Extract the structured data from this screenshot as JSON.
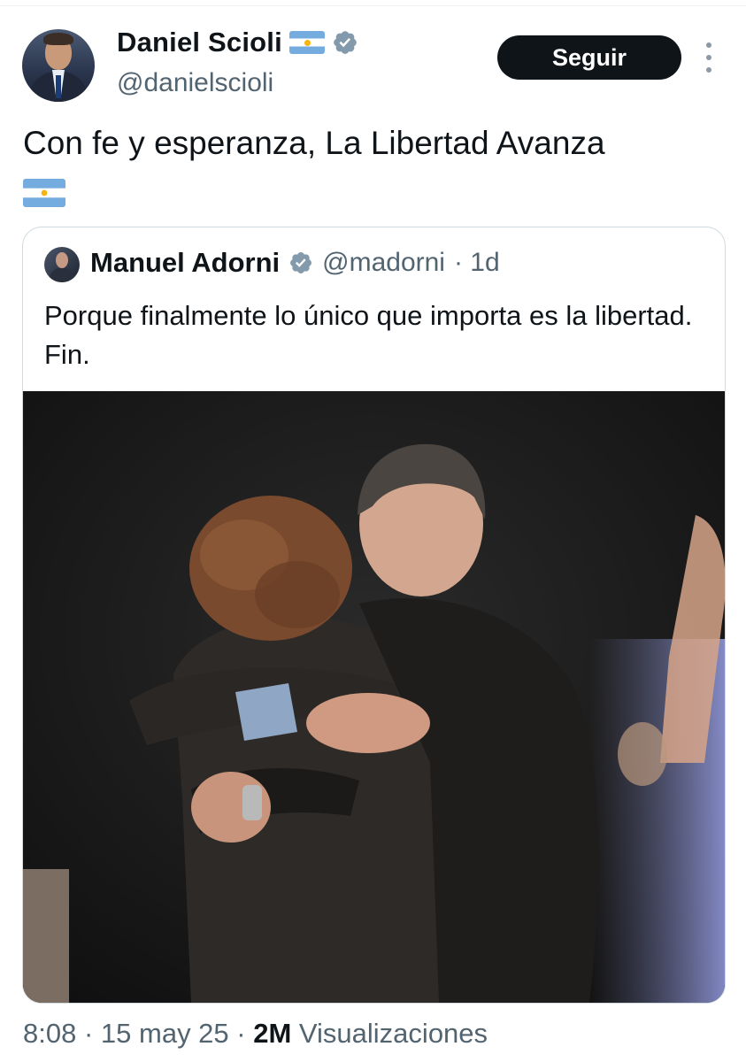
{
  "author": {
    "display_name": "Daniel Scioli",
    "handle": "@danielscioli",
    "flag_icon": "argentina-flag-icon",
    "verified_icon": "verified-badge-icon"
  },
  "header": {
    "follow_label": "Seguir",
    "more_icon": "more-options-icon"
  },
  "tweet": {
    "text": "Con fe y esperanza, La Libertad Avanza",
    "trailing_emoji": "argentina-flag-icon"
  },
  "quoted_tweet": {
    "display_name": "Manuel Adorni",
    "handle": "@madorni",
    "age": "· 1d",
    "text": "Porque finalmente lo único que importa es la libertad. Fin.",
    "media": "photo"
  },
  "meta": {
    "time": "8:08",
    "sep1": " · ",
    "date": "15 may 25",
    "sep2": " · ",
    "views_count": "2M",
    "views_label": " Visualizaciones"
  },
  "colors": {
    "text": "#0f1419",
    "secondary": "#536471",
    "verified": "#829aab",
    "button_bg": "#0f1419",
    "border": "#cfd9de"
  }
}
